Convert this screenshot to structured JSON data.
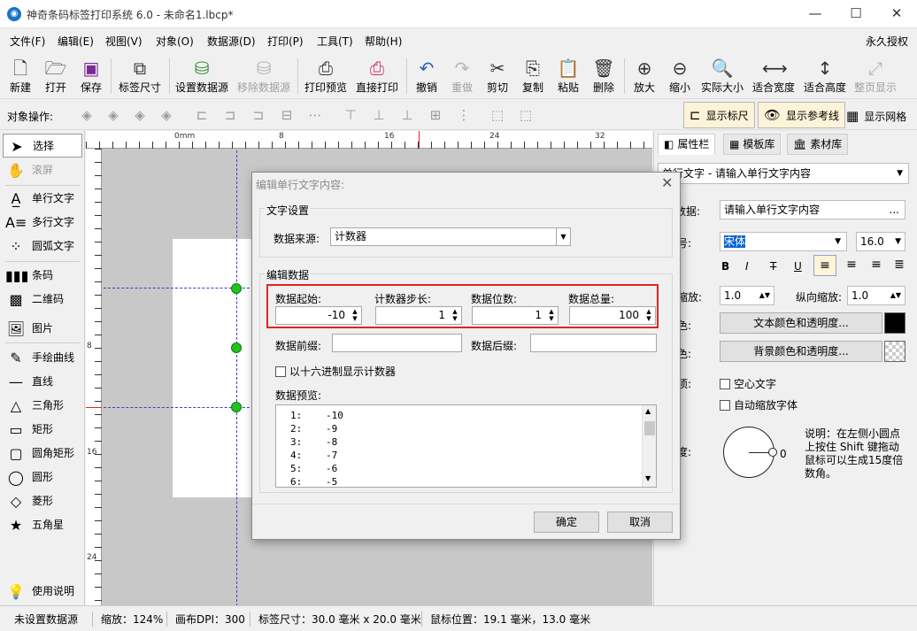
{
  "window": {
    "title": "神奇条码标签打印系统 6.0 - 未命名1.lbcp*",
    "app_icon": "app-logo-icon",
    "right_label": "永久授权"
  },
  "menu": [
    "文件(F)",
    "编辑(E)",
    "视图(V)",
    "对象(O)",
    "数据源(D)",
    "打印(P)",
    "工具(T)",
    "帮助(H)"
  ],
  "toolbar": [
    {
      "label": "新建",
      "icon": "new-file-icon"
    },
    {
      "label": "打开",
      "icon": "open-icon"
    },
    {
      "label": "保存",
      "icon": "save-icon"
    },
    {
      "label": "标签尺寸",
      "icon": "label-size-icon"
    },
    {
      "label": "设置数据源",
      "icon": "database-icon"
    },
    {
      "label": "移除数据源",
      "icon": "remove-database-icon"
    },
    {
      "label": "打印预览",
      "icon": "print-preview-icon"
    },
    {
      "label": "直接打印",
      "icon": "printer-icon"
    },
    {
      "label": "撤销",
      "icon": "undo-icon"
    },
    {
      "label": "重做",
      "icon": "redo-icon"
    },
    {
      "label": "剪切",
      "icon": "scissors-icon"
    },
    {
      "label": "复制",
      "icon": "copy-icon"
    },
    {
      "label": "粘贴",
      "icon": "paste-icon"
    },
    {
      "label": "删除",
      "icon": "trash-icon"
    },
    {
      "label": "放大",
      "icon": "zoom-in-icon"
    },
    {
      "label": "缩小",
      "icon": "zoom-out-icon"
    },
    {
      "label": "实际大小",
      "icon": "actual-size-icon"
    },
    {
      "label": "适合宽度",
      "icon": "fit-width-icon"
    },
    {
      "label": "适合高度",
      "icon": "fit-height-icon"
    },
    {
      "label": "整页显示",
      "icon": "full-page-icon"
    }
  ],
  "opsbar": {
    "label": "对象操作:",
    "show_ruler": "显示标尺",
    "show_guides": "显示参考线",
    "show_grid": "显示网格"
  },
  "tools": [
    "选择",
    "滚屏",
    "单行文字",
    "多行文字",
    "圆弧文字",
    "条码",
    "二维码",
    "图片",
    "手绘曲线",
    "直线",
    "三角形",
    "矩形",
    "圆角矩形",
    "圆形",
    "菱形",
    "五角星",
    "使用说明"
  ],
  "ruler": {
    "top": [
      "0mm",
      "8",
      "16",
      "24",
      "32"
    ],
    "left": [
      "8",
      "16",
      "24"
    ]
  },
  "right_panel": {
    "tabs": [
      "属性栏",
      "模板库",
      "素材库"
    ],
    "object_select": "单行文字 - 请输入单行文字内容",
    "data_label": "数据:",
    "data_value": "请输入单行文字内容",
    "font_label": "字号:",
    "font_name": "宋体",
    "font_size": "16.0",
    "style_buttons": [
      "B",
      "I",
      "T",
      "U"
    ],
    "hscale_label": "向缩放:",
    "hscale": "1.0",
    "vscale_label": "纵向缩放:",
    "vscale": "1.0",
    "text_color_label": "颜色:",
    "text_color_btn": "文本颜色和透明度...",
    "text_color": "#000000",
    "bg_color_label": "颜色:",
    "bg_color_btn": "背景颜色和透明度...",
    "options_label": "选项:",
    "hollow_text": "空心文字",
    "auto_scale": "自动缩放字体",
    "angle_label": "角度:",
    "angle_value": "0",
    "angle_help": "说明：在左侧小圆点上按住 Shift 键拖动鼠标可以生成15度倍数角。"
  },
  "dialog": {
    "title": "编辑单行文字内容:",
    "text_settings": "文字设置",
    "data_source_label": "数据来源:",
    "data_source_value": "计数器",
    "edit_data": "编辑数据",
    "start_label": "数据起始:",
    "start_value": "-10",
    "step_label": "计数器步长:",
    "step_value": "1",
    "digits_label": "数据位数:",
    "digits_value": "1",
    "total_label": "数据总量:",
    "total_value": "100",
    "prefix_label": "数据前缀:",
    "prefix_value": "",
    "suffix_label": "数据后缀:",
    "suffix_value": "",
    "hex_checkbox": "以十六进制显示计数器",
    "preview_label": "数据预览:",
    "preview_rows": [
      {
        "n": "1:",
        "v": "-10"
      },
      {
        "n": "2:",
        "v": "-9"
      },
      {
        "n": "3:",
        "v": "-8"
      },
      {
        "n": "4:",
        "v": "-7"
      },
      {
        "n": "5:",
        "v": "-6"
      },
      {
        "n": "6:",
        "v": "-5"
      }
    ],
    "ok": "确定",
    "cancel": "取消"
  },
  "status": {
    "datasource": "未设置数据源",
    "zoom": "缩放：124%",
    "dpi": "画布DPI：300",
    "label_size": "标签尺寸：30.0 毫米 x 20.0 毫米",
    "mouse_pos": "鼠标位置：19.1 毫米，13.0 毫米"
  },
  "colors": {
    "accent": "#1a73c8",
    "highlight_border": "#e02424",
    "handle": "#22c21f",
    "guide": "#3b3bd6"
  }
}
